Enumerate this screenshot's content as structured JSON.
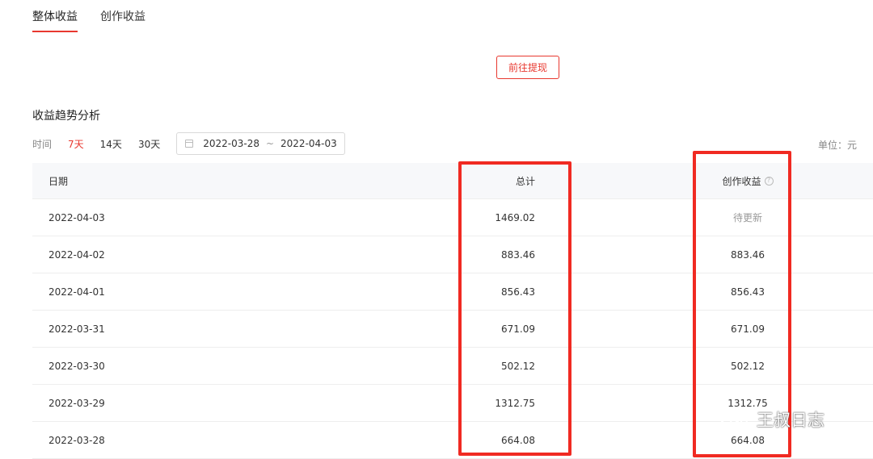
{
  "tabs": [
    {
      "label": "整体收益",
      "active": true
    },
    {
      "label": "创作收益",
      "active": false
    }
  ],
  "withdraw_button": "前往提现",
  "section_title": "收益趋势分析",
  "filters": {
    "time_label": "时间",
    "ranges": [
      {
        "label": "7天",
        "active": true
      },
      {
        "label": "14天",
        "active": false
      },
      {
        "label": "30天",
        "active": false
      }
    ],
    "date_start": "2022-03-28",
    "date_sep": "~",
    "date_end": "2022-04-03",
    "calendar_icon": "calendar-icon"
  },
  "unit_label": "单位：元",
  "table": {
    "headers": {
      "date": "日期",
      "total": "总计",
      "creation": "创作收益",
      "help_icon": "?"
    },
    "rows": [
      {
        "date": "2022-04-03",
        "total": "1469.02",
        "creation": "待更新"
      },
      {
        "date": "2022-04-02",
        "total": "883.46",
        "creation": "883.46"
      },
      {
        "date": "2022-04-01",
        "total": "856.43",
        "creation": "856.43"
      },
      {
        "date": "2022-03-31",
        "total": "671.09",
        "creation": "671.09"
      },
      {
        "date": "2022-03-30",
        "total": "502.12",
        "creation": "502.12"
      },
      {
        "date": "2022-03-29",
        "total": "1312.75",
        "creation": "1312.75"
      },
      {
        "date": "2022-03-28",
        "total": "664.08",
        "creation": "664.08"
      }
    ]
  },
  "watermark": {
    "text": "王叔日志",
    "icon": "wechat-icon"
  },
  "colors": {
    "accent": "#e8382f",
    "highlight": "#f02a22"
  }
}
